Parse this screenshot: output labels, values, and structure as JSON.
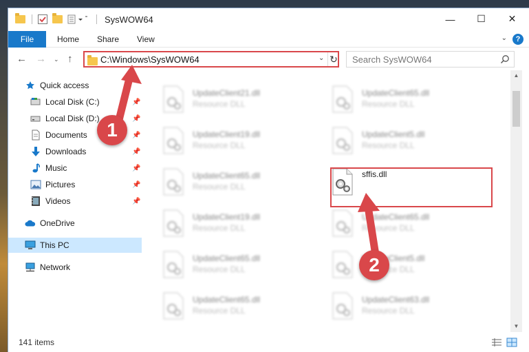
{
  "window": {
    "title": "SysWOW64"
  },
  "controls": {
    "minimize": "—",
    "maximize": "☐",
    "close": "✕"
  },
  "ribbon": {
    "tabs": [
      "File",
      "Home",
      "Share",
      "View"
    ],
    "help": "?"
  },
  "nav": {
    "address": "C:\\Windows\\SysWOW64",
    "search_placeholder": "Search SysWOW64"
  },
  "sidebar": {
    "items": [
      {
        "label": "Quick access",
        "icon": "star-icon",
        "pinned": false
      },
      {
        "label": "Local Disk (C:)",
        "icon": "drive-icon",
        "pinned": true
      },
      {
        "label": "Local Disk (D:)",
        "icon": "drive-icon",
        "pinned": true
      },
      {
        "label": "Documents",
        "icon": "document-icon",
        "pinned": true
      },
      {
        "label": "Downloads",
        "icon": "download-icon",
        "pinned": true
      },
      {
        "label": "Music",
        "icon": "music-icon",
        "pinned": true
      },
      {
        "label": "Pictures",
        "icon": "picture-icon",
        "pinned": true
      },
      {
        "label": "Videos",
        "icon": "video-icon",
        "pinned": true
      },
      {
        "label": "OneDrive",
        "icon": "cloud-icon",
        "pinned": false
      },
      {
        "label": "This PC",
        "icon": "computer-icon",
        "pinned": false,
        "selected": true
      },
      {
        "label": "Network",
        "icon": "network-icon",
        "pinned": false
      }
    ]
  },
  "files": {
    "left": [
      {
        "name": "UpdateClient21.dll",
        "type": "Resource DLL"
      },
      {
        "name": "UpdateClient19.dll",
        "type": "Resource DLL"
      },
      {
        "name": "UpdateClient65.dll",
        "type": "Resource DLL"
      },
      {
        "name": "UpdateClient19.dll",
        "type": "Resource DLL"
      },
      {
        "name": "UpdateClient65.dll",
        "type": "Resource DLL"
      },
      {
        "name": "UpdateClient65.dll",
        "type": "Resource DLL"
      }
    ],
    "right": [
      {
        "name": "UpdateClient65.dll",
        "type": "Resource DLL"
      },
      {
        "name": "UpdateClient5.dll",
        "type": "Resource DLL"
      },
      {
        "name": "sffis.dll",
        "type": "",
        "highlighted": true
      },
      {
        "name": "UpdateClient65.dll",
        "type": "Resource DLL"
      },
      {
        "name": "UpdateClient5.dll",
        "type": "Resource DLL"
      },
      {
        "name": "UpdateClient63.dll",
        "type": "Resource DLL"
      }
    ]
  },
  "status": {
    "items_count": "141 items"
  },
  "annotations": {
    "step1": "1",
    "step2": "2",
    "accent": "#d9474a"
  }
}
